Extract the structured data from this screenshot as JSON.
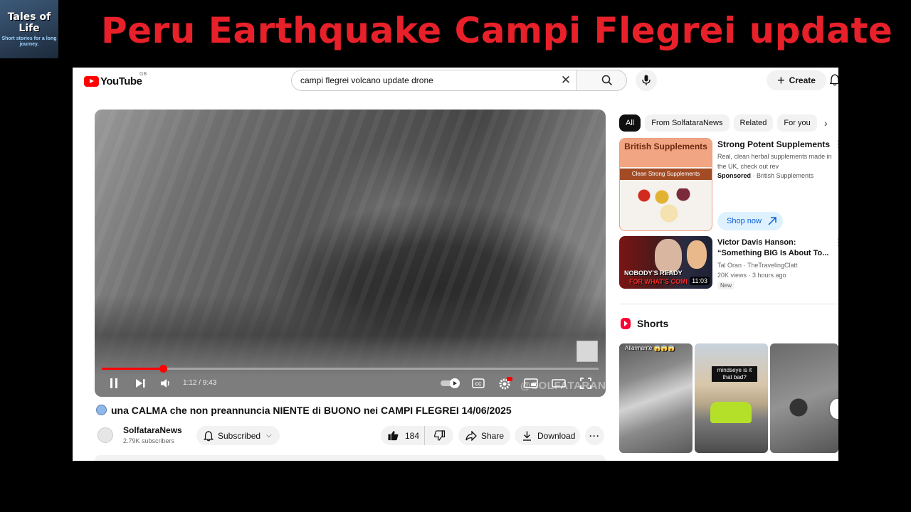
{
  "overlay": {
    "brand_line1": "Tales of",
    "brand_line2": "Life",
    "brand_tagline": "Short stories for a long journey.",
    "headline": "Peru Earthquake Campi Flegrei update",
    "headline_color": "#e8202a"
  },
  "header": {
    "logo_text": "YouTube",
    "country_code": "GB",
    "search_value": "campi flegrei volcano update drone",
    "create_label": "Create"
  },
  "player": {
    "time_display": "1:12 / 9:43",
    "progress_fraction": 0.1235,
    "watermark": "@SOLFATARANEWS",
    "settings_badge": "HD",
    "accent": "#ff0000"
  },
  "video": {
    "title": "una CALMA che non preannuncia NIENTE di BUONO nei CAMPI FLEGREI 14/06/2025",
    "channel_name": "SolfataraNews",
    "subscribers": "2.79K subscribers",
    "subscribed_label": "Subscribed",
    "like_count": "184",
    "share_label": "Share",
    "download_label": "Download"
  },
  "sidebar": {
    "chips": [
      "All",
      "From SolfataraNews",
      "Related",
      "For you"
    ],
    "ad": {
      "thumb_title": "British Supplements",
      "thumb_band": "Clean Strong Supplements",
      "title": "Strong Potent Supplements",
      "description": "Real, clean herbal supplements made in the UK, check out rev",
      "sponsored": "Sponsored",
      "advertiser": "· British Supplements",
      "cta": "Shop now"
    },
    "video2": {
      "title": "Victor Davis Hanson: “Something BIG Is About To...",
      "channel": "Tal Oran · TheTravelingClatt",
      "meta": "20K views · 3 hours ago",
      "badge": "New",
      "duration": "11:03",
      "thumb_caption1": "NOBODY'S READY",
      "thumb_caption2": "FOR WHAT'S COMI"
    },
    "shorts_heading": "Shorts",
    "shorts": [
      {
        "label": "Allarmante 😱😱😱"
      },
      {
        "label": "mindseye is it that bad?"
      },
      {
        "label": ""
      }
    ]
  }
}
